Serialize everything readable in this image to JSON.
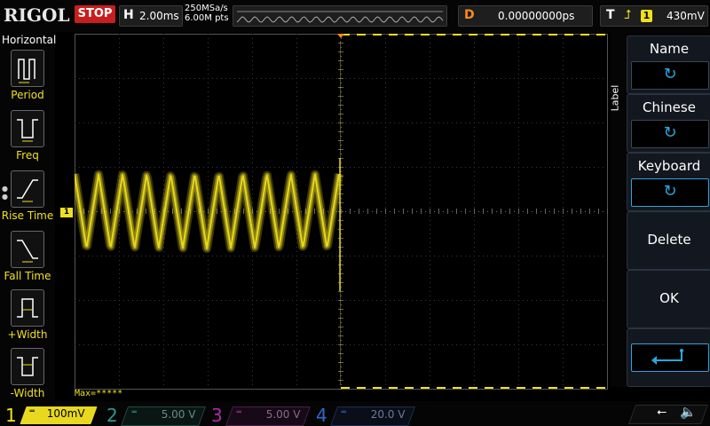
{
  "brand": {
    "logo": "RIGOL"
  },
  "run_state": {
    "label": "STOP",
    "color": "#c81e1e"
  },
  "horizontal": {
    "key": "H",
    "timebase": "2.00ms",
    "sample_rate": "250MSa/s",
    "memory_depth": "6.00M pts"
  },
  "delay": {
    "key": "D",
    "value": "0.00000000ps"
  },
  "trigger": {
    "key": "T",
    "edge_icon": "rising-edge-icon",
    "source": "1",
    "level": "430mV"
  },
  "left_menu": {
    "title": "Horizontal",
    "items": [
      {
        "label": "Period",
        "icon": "period-measure-icon"
      },
      {
        "label": "Freq",
        "icon": "frequency-measure-icon"
      },
      {
        "label": "Rise Time",
        "icon": "rise-time-icon"
      },
      {
        "label": "Fall Time",
        "icon": "fall-time-icon"
      },
      {
        "label": "+Width",
        "icon": "positive-width-icon"
      },
      {
        "label": "-Width",
        "icon": "negative-width-icon"
      }
    ]
  },
  "right_menu": {
    "tab_label": "Label",
    "buttons": [
      {
        "title": "Name",
        "icon": "rotate-knob-icon"
      },
      {
        "title": "Chinese",
        "icon": "rotate-knob-icon"
      },
      {
        "title": "Keyboard",
        "icon": "rotate-knob-icon"
      },
      {
        "title": "Delete"
      },
      {
        "title": "OK"
      },
      {
        "icon": "enter-arrow-icon"
      }
    ]
  },
  "display": {
    "ch1_marker": "1",
    "measurement_readout": "Max=*****",
    "trace_color": "#f0e020"
  },
  "channels": [
    {
      "number": "1",
      "scale": "100mV",
      "color": "#f0e020",
      "active": true
    },
    {
      "number": "2",
      "scale": "5.00 V",
      "color": "#2a9a8c",
      "active": false
    },
    {
      "number": "3",
      "scale": "5.00 V",
      "color": "#b02ab0",
      "active": false
    },
    {
      "number": "4",
      "scale": "20.0 V",
      "color": "#2a6ad0",
      "active": false
    }
  ],
  "status_icons": {
    "usb": "usb-icon",
    "sound": "speaker-muted-icon"
  }
}
